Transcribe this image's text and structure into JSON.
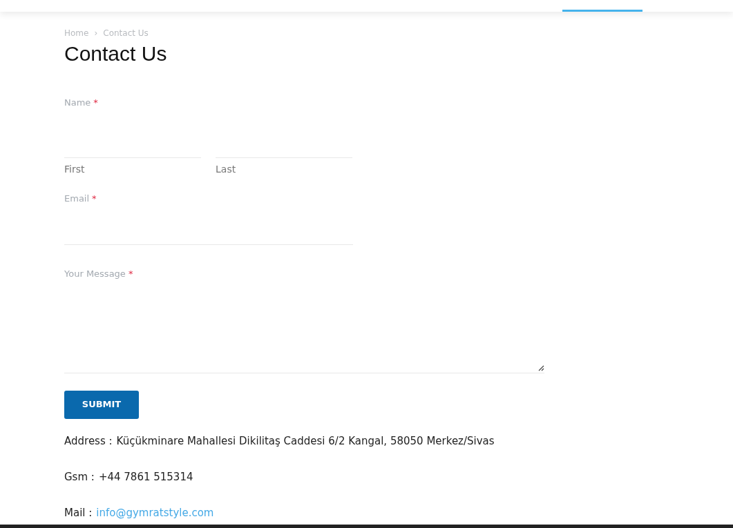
{
  "breadcrumb": [
    {
      "label": "Home"
    },
    {
      "label": "Contact Us"
    }
  ],
  "breadcrumb_separator": "›",
  "title": "Contact Us",
  "form": {
    "name": {
      "label": "Name",
      "required_mark": "*",
      "parts": [
        {
          "sublabel": "First"
        },
        {
          "sublabel": "Last"
        }
      ]
    },
    "email": {
      "label": "Email",
      "required_mark": "*"
    },
    "message": {
      "label": "Your Message",
      "required_mark": "*"
    },
    "submit": "SUBMIT"
  },
  "contact": [
    {
      "kind": "text",
      "label": "Address :",
      "value": "Küçükminare Mahallesi Dikilitaş Caddesi 6/2 Kangal, 58050 Merkez/Sivas"
    },
    {
      "kind": "text",
      "label": "Gsm :",
      "value": "+44 7861 515314"
    },
    {
      "kind": "link",
      "label": "Mail :",
      "value": "info@gymratstyle.com"
    }
  ]
}
